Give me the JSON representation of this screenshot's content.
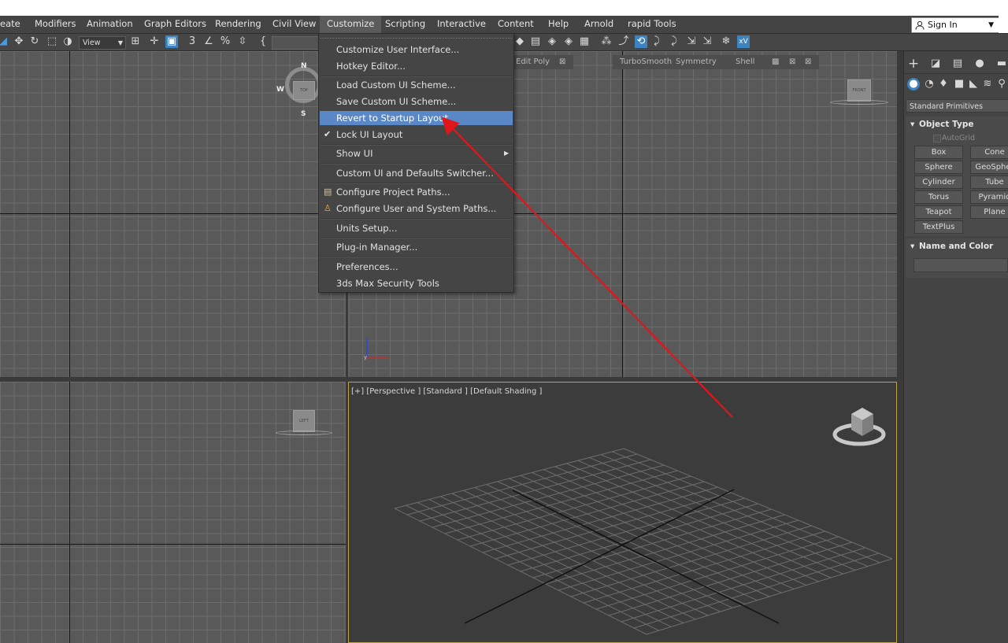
{
  "menubar": {
    "items": [
      "eate",
      "Modifiers",
      "Animation",
      "Graph Editors",
      "Rendering",
      "Civil View",
      "Customize",
      "Scripting",
      "Interactive",
      "Content",
      "Help",
      "Arnold",
      "rapid Tools"
    ],
    "active": "Customize",
    "sign_in": "Sign In"
  },
  "toolbar": {
    "view_dropdown": "View"
  },
  "customize_menu": {
    "items": [
      {
        "label": "Customize User Interface..."
      },
      {
        "label": "Hotkey Editor..."
      },
      {
        "label": "Load Custom UI Scheme..."
      },
      {
        "label": "Save Custom UI Scheme..."
      },
      {
        "label": "Revert to Startup Layout",
        "highlighted": true
      },
      {
        "label": "Lock UI Layout",
        "checked": true
      },
      {
        "label": "Show UI",
        "submenu": true
      },
      {
        "label": "Custom UI and Defaults Switcher..."
      },
      {
        "label": "Configure Project Paths..."
      },
      {
        "label": "Configure User and System Paths..."
      },
      {
        "label": "Units Setup..."
      },
      {
        "label": "Plug-in Manager..."
      },
      {
        "label": "Preferences..."
      },
      {
        "label": "3ds Max Security Tools"
      }
    ]
  },
  "modifier_strip": {
    "items": [
      "Edit Poly",
      "TurboSmooth",
      "Symmetry",
      "Shell"
    ]
  },
  "viewports": {
    "top": {
      "cube_label": "TOP",
      "compass": [
        "N",
        "W",
        "S"
      ]
    },
    "front": {
      "cube_label": "FRONT"
    },
    "left": {
      "cube_label": "LEFT"
    },
    "perspective": {
      "label": "[+] [Perspective ] [Standard ] [Default Shading ]"
    }
  },
  "command_panel": {
    "category": "Standard Primitives",
    "object_type_title": "Object Type",
    "autogrid": "AutoGrid",
    "buttons": [
      "Box",
      "Cone",
      "Sphere",
      "GeoSpher",
      "Cylinder",
      "Tube",
      "Torus",
      "Pyramid",
      "Teapot",
      "Plane",
      "TextPlus"
    ],
    "name_color_title": "Name and Color"
  },
  "colors": {
    "menu_highlight": "#5a88c6",
    "annotation_arrow": "#e0161b",
    "active_viewport_border": "#b9a448"
  }
}
